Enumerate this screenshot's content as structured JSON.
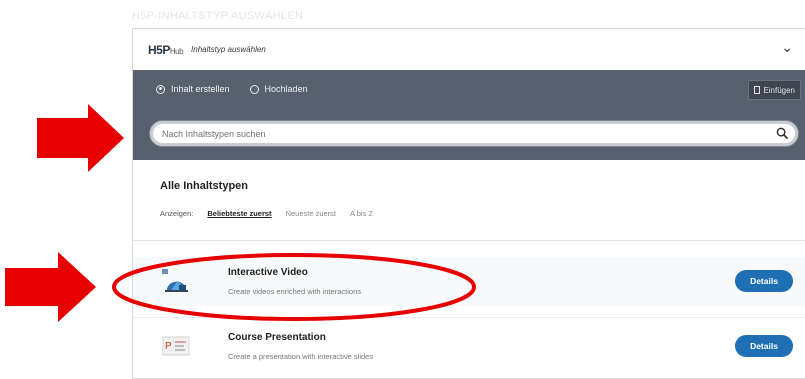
{
  "faded_header": "H5P-INHALTSTYP AUSWÄHLEN",
  "hub": {
    "logo_main": "H5P",
    "logo_small": "Hub",
    "title": "Inhaltstyp auswählen",
    "chevron": "⌄"
  },
  "tabs": {
    "create": "Inhalt erstellen",
    "upload": "Hochladen",
    "paste": "Einfügen"
  },
  "search": {
    "placeholder": "Nach Inhaltstypen suchen"
  },
  "list": {
    "heading": "Alle Inhaltstypen",
    "sort_label": "Anzeigen:",
    "sort_options": [
      "Beliebteste zuerst",
      "Neueste zuerst",
      "A bis Z"
    ],
    "items": [
      {
        "title": "Interactive Video",
        "description": "Create videos enriched with interactions",
        "button": "Details",
        "icon": "interactive-video-icon"
      },
      {
        "title": "Course Presentation",
        "description": "Create a presentation with interactive slides",
        "button": "Details",
        "icon": "course-presentation-icon"
      }
    ]
  },
  "colors": {
    "dark_bar": "#57606c",
    "details_button": "#1f6fb5",
    "annotation_red": "#e60000"
  }
}
